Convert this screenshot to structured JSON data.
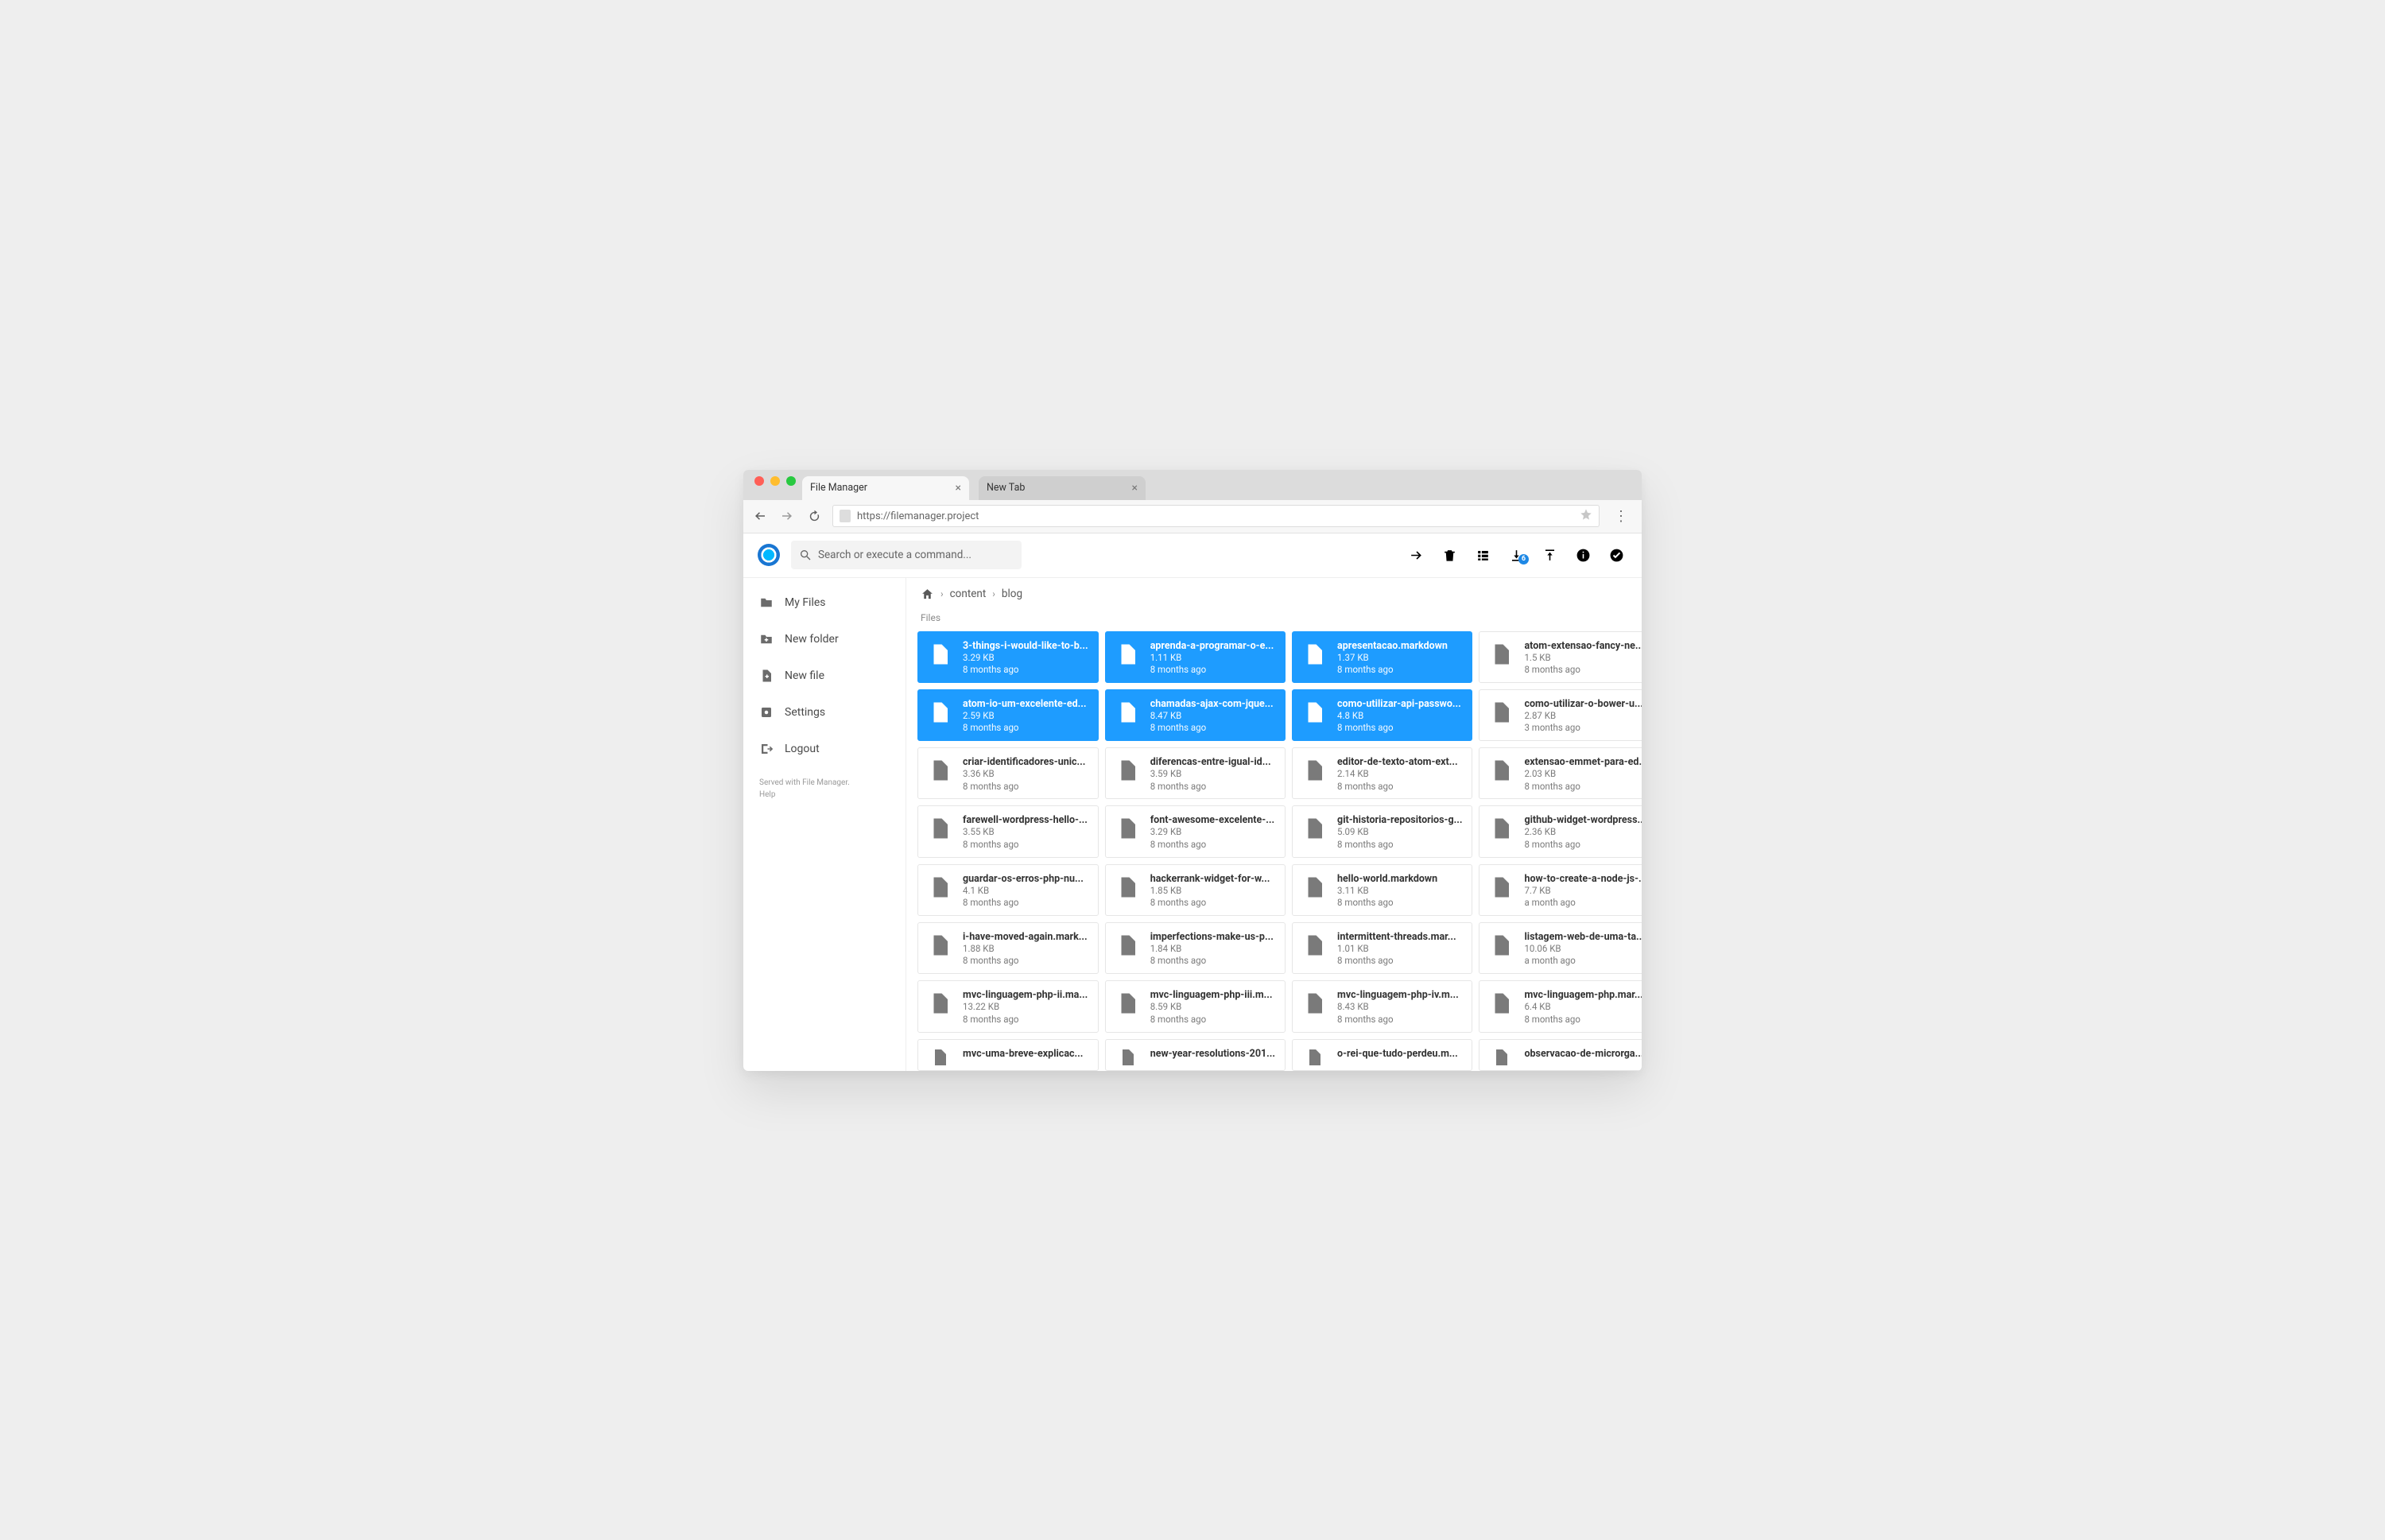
{
  "chrome": {
    "tabs": [
      {
        "title": "File Manager",
        "active": true
      },
      {
        "title": "New Tab",
        "active": false
      }
    ],
    "url": "https://filemanager.project"
  },
  "appbar": {
    "search_placeholder": "Search or execute a command...",
    "download_badge": "6"
  },
  "sidebar": {
    "items": [
      {
        "id": "myfiles",
        "label": "My Files",
        "icon": "folder"
      },
      {
        "id": "newfolder",
        "label": "New folder",
        "icon": "newfolder"
      },
      {
        "id": "newfile",
        "label": "New file",
        "icon": "newfile"
      },
      {
        "id": "settings",
        "label": "Settings",
        "icon": "settings"
      },
      {
        "id": "logout",
        "label": "Logout",
        "icon": "logout"
      }
    ],
    "footer_line1": "Served with File Manager.",
    "footer_line2": "Help"
  },
  "breadcrumbs": [
    "content",
    "blog"
  ],
  "section_label": "Files",
  "files": [
    {
      "name": "3-things-i-would-like-to-b...",
      "size": "3.29 KB",
      "date": "8 months ago",
      "selected": true
    },
    {
      "name": "aprenda-a-programar-o-e...",
      "size": "1.11 KB",
      "date": "8 months ago",
      "selected": true
    },
    {
      "name": "apresentacao.markdown",
      "size": "1.37 KB",
      "date": "8 months ago",
      "selected": true
    },
    {
      "name": "atom-extensao-fancy-ne...",
      "size": "1.5 KB",
      "date": "8 months ago",
      "selected": false
    },
    {
      "name": "atom-io-um-excelente-ed...",
      "size": "2.59 KB",
      "date": "8 months ago",
      "selected": true
    },
    {
      "name": "chamadas-ajax-com-jque...",
      "size": "8.47 KB",
      "date": "8 months ago",
      "selected": true
    },
    {
      "name": "como-utilizar-api-passwo...",
      "size": "4.8 KB",
      "date": "8 months ago",
      "selected": true
    },
    {
      "name": "como-utilizar-o-bower-u...",
      "size": "2.87 KB",
      "date": "3 months ago",
      "selected": false
    },
    {
      "name": "criar-identificadores-unic...",
      "size": "3.36 KB",
      "date": "8 months ago",
      "selected": false
    },
    {
      "name": "diferencas-entre-igual-id...",
      "size": "3.59 KB",
      "date": "8 months ago",
      "selected": false
    },
    {
      "name": "editor-de-texto-atom-ext...",
      "size": "2.14 KB",
      "date": "8 months ago",
      "selected": false
    },
    {
      "name": "extensao-emmet-para-ed...",
      "size": "2.03 KB",
      "date": "8 months ago",
      "selected": false
    },
    {
      "name": "farewell-wordpress-hello-...",
      "size": "3.55 KB",
      "date": "8 months ago",
      "selected": false
    },
    {
      "name": "font-awesome-excelente-...",
      "size": "3.29 KB",
      "date": "8 months ago",
      "selected": false
    },
    {
      "name": "git-historia-repositorios-g...",
      "size": "5.09 KB",
      "date": "8 months ago",
      "selected": false
    },
    {
      "name": "github-widget-wordpress....",
      "size": "2.36 KB",
      "date": "8 months ago",
      "selected": false
    },
    {
      "name": "guardar-os-erros-php-nu...",
      "size": "4.1 KB",
      "date": "8 months ago",
      "selected": false
    },
    {
      "name": "hackerrank-widget-for-w...",
      "size": "1.85 KB",
      "date": "8 months ago",
      "selected": false
    },
    {
      "name": "hello-world.markdown",
      "size": "3.11 KB",
      "date": "8 months ago",
      "selected": false
    },
    {
      "name": "how-to-create-a-node-js-...",
      "size": "7.7 KB",
      "date": "a month ago",
      "selected": false
    },
    {
      "name": "i-have-moved-again.mark...",
      "size": "1.88 KB",
      "date": "8 months ago",
      "selected": false
    },
    {
      "name": "imperfections-make-us-p...",
      "size": "1.84 KB",
      "date": "8 months ago",
      "selected": false
    },
    {
      "name": "intermittent-threads.mar...",
      "size": "1.01 KB",
      "date": "8 months ago",
      "selected": false
    },
    {
      "name": "listagem-web-de-uma-ta...",
      "size": "10.06 KB",
      "date": "a month ago",
      "selected": false
    },
    {
      "name": "mvc-linguagem-php-ii.ma...",
      "size": "13.22 KB",
      "date": "8 months ago",
      "selected": false
    },
    {
      "name": "mvc-linguagem-php-iii.m...",
      "size": "8.59 KB",
      "date": "8 months ago",
      "selected": false
    },
    {
      "name": "mvc-linguagem-php-iv.m...",
      "size": "8.43 KB",
      "date": "8 months ago",
      "selected": false
    },
    {
      "name": "mvc-linguagem-php.mar...",
      "size": "6.4 KB",
      "date": "8 months ago",
      "selected": false
    },
    {
      "name": "mvc-uma-breve-explicac...",
      "size": "",
      "date": "",
      "selected": false,
      "cut": true
    },
    {
      "name": "new-year-resolutions-201...",
      "size": "",
      "date": "",
      "selected": false,
      "cut": true
    },
    {
      "name": "o-rei-que-tudo-perdeu.m...",
      "size": "",
      "date": "",
      "selected": false,
      "cut": true
    },
    {
      "name": "observacao-de-microrga...",
      "size": "",
      "date": "",
      "selected": false,
      "cut": true
    }
  ]
}
